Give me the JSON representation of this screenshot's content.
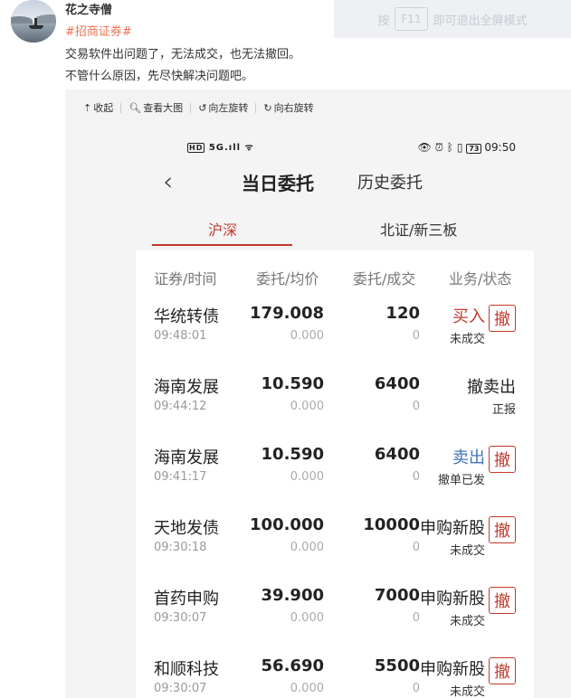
{
  "post": {
    "username": "花之寺僧",
    "hashtag": "#招商证券#",
    "lines": [
      "交易软件出问题了，无法成交，也无法撤回。",
      "不管什么原因，先尽快解决问题吧。"
    ]
  },
  "fullscreen_hint": {
    "before": "按",
    "key": "F11",
    "after": "即可退出全屏模式"
  },
  "toolbar": {
    "collapse": "收起",
    "view_large": "查看大图",
    "rotate_left": "向左旋转",
    "rotate_right": "向右旋转"
  },
  "phone": {
    "status": {
      "network": "5G",
      "time": "09:50",
      "battery": "73"
    },
    "nav": {
      "tab_today": "当日委托",
      "tab_history": "历史委托"
    },
    "subtabs": {
      "a": "沪深",
      "b": "北证/新三板"
    },
    "columns": [
      "证券/时间",
      "委托/均价",
      "委托/成交",
      "业务/状态"
    ],
    "orders": [
      {
        "name": "华统转债",
        "time": "09:48:01",
        "price": "179.008",
        "avg": "0.000",
        "qty": "120",
        "filled": "0",
        "biz": "买入",
        "status": "未成交",
        "cancel": "撤"
      },
      {
        "name": "海南发展",
        "time": "09:44:12",
        "price": "10.590",
        "avg": "0.000",
        "qty": "6400",
        "filled": "0",
        "biz": "撤卖出",
        "status": "正报"
      },
      {
        "name": "海南发展",
        "time": "09:41:17",
        "price": "10.590",
        "avg": "0.000",
        "qty": "6400",
        "filled": "0",
        "biz": "卖出",
        "status": "撤单已发",
        "cancel": "撤"
      },
      {
        "name": "天地发债",
        "time": "09:30:18",
        "price": "100.000",
        "avg": "0.000",
        "qty": "10000",
        "filled": "0",
        "biz": "申购新股",
        "status": "未成交",
        "cancel": "撤"
      },
      {
        "name": "首药申购",
        "time": "09:30:07",
        "price": "39.900",
        "avg": "0.000",
        "qty": "7000",
        "filled": "0",
        "biz": "申购新股",
        "status": "未成交",
        "cancel": "撤"
      },
      {
        "name": "和顺科技",
        "time": "09:30:07",
        "price": "56.690",
        "avg": "0.000",
        "qty": "5500",
        "filled": "0",
        "biz": "申购新股",
        "status": "未成交",
        "cancel": "撤"
      }
    ]
  },
  "colors": {
    "red": "#c0392b",
    "blue": "#3f75b8",
    "hashtag": "#eb7350"
  }
}
